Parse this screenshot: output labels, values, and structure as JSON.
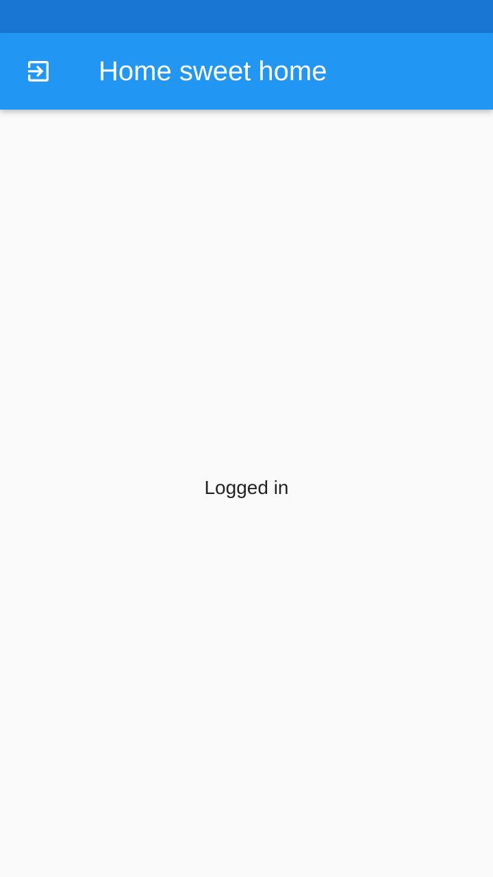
{
  "status_bar": {
    "color": "#1976d2"
  },
  "app_bar": {
    "title": "Home sweet home",
    "color": "#2196f3",
    "leading_icon": "exit-to-app-icon"
  },
  "main": {
    "message": "Logged in",
    "background": "#fafafa"
  }
}
